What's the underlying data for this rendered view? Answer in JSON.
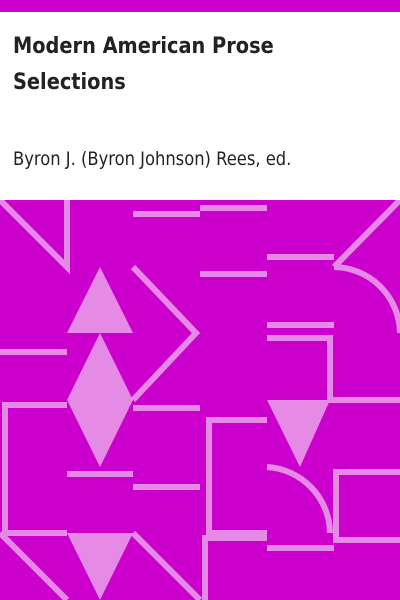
{
  "book": {
    "title": "Modern American Prose Selections",
    "author": "Byron J. (Byron Johnson) Rees, ed."
  },
  "colors": {
    "top_bar": "#cc00cc",
    "text": "#222222",
    "pattern_bg": "#cc00cc",
    "pattern_fg": "#e58ae5"
  }
}
